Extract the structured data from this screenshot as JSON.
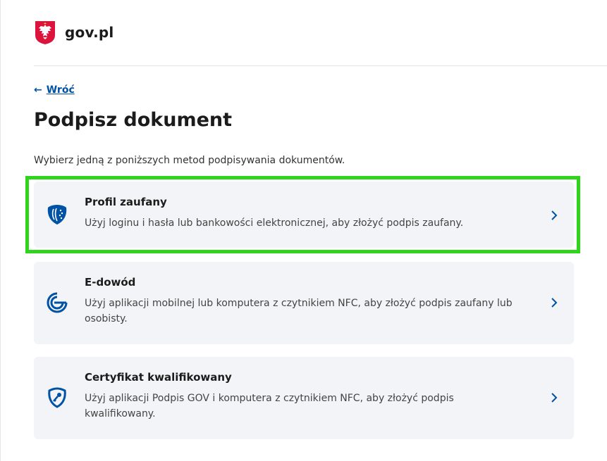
{
  "header": {
    "brand": "gov.pl",
    "emblem_icon": "polish-eagle-emblem"
  },
  "nav": {
    "back_label": "Wróć",
    "back_arrow": "←"
  },
  "page": {
    "title": "Podpisz dokument",
    "intro": "Wybierz jedną z poniższych metod podpisywania dokumentów."
  },
  "methods": [
    {
      "title": "Profil zaufany",
      "description": "Użyj loginu i hasła lub bankowości elektronicznej, aby złożyć podpis zaufany.",
      "icon": "trusted-profile-icon",
      "highlighted": true
    },
    {
      "title": "E-dowód",
      "description": "Użyj aplikacji mobilnej lub komputera z czytnikiem NFC, aby złożyć podpis zaufany lub osobisty.",
      "icon": "e-id-icon",
      "highlighted": false
    },
    {
      "title": "Certyfikat kwalifikowany",
      "description": "Użyj aplikacji Podpis GOV i komputera z czytnikiem NFC, aby złożyć podpis kwalifikowany.",
      "icon": "qualified-certificate-icon",
      "highlighted": false
    }
  ],
  "colors": {
    "link": "#0052a5",
    "icon_blue": "#0052a5",
    "card_bg": "#f3f4f7",
    "highlight": "#2fd51b",
    "emblem_red": "#dc143c"
  }
}
